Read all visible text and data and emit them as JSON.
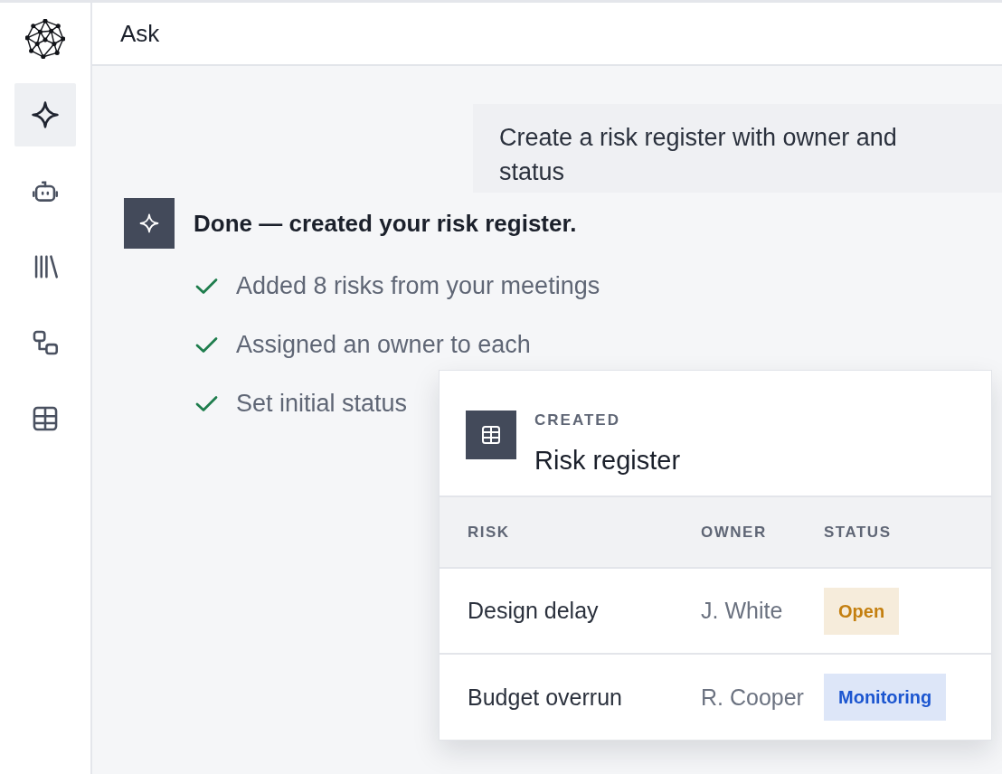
{
  "sidebar": {
    "items": [
      {
        "selected": true
      },
      {
        "selected": false
      },
      {
        "selected": false
      },
      {
        "selected": false
      },
      {
        "selected": false
      }
    ]
  },
  "header": {
    "title": "Ask"
  },
  "conversation": {
    "user_message": "Create a risk register with owner and status",
    "assistant": {
      "title": "Done — created your risk register.",
      "steps": [
        {
          "text": "Added 8 risks from your meetings",
          "checked": true
        },
        {
          "text": "Assigned an owner to each",
          "checked": true
        },
        {
          "text": "Set initial status",
          "checked": true
        }
      ],
      "card": {
        "label": "CREATED",
        "title": "Risk register",
        "table": {
          "columns": [
            "RISK",
            "OWNER",
            "STATUS"
          ],
          "rows": [
            {
              "risk": "Design delay",
              "owner": "J. White",
              "status": {
                "label": "Open",
                "color": "#c47f0f"
              }
            },
            {
              "risk": "Budget overrun",
              "owner": "R. Cooper",
              "status": {
                "label": "Monitoring",
                "color": "#1c56d0"
              }
            }
          ]
        }
      }
    }
  }
}
